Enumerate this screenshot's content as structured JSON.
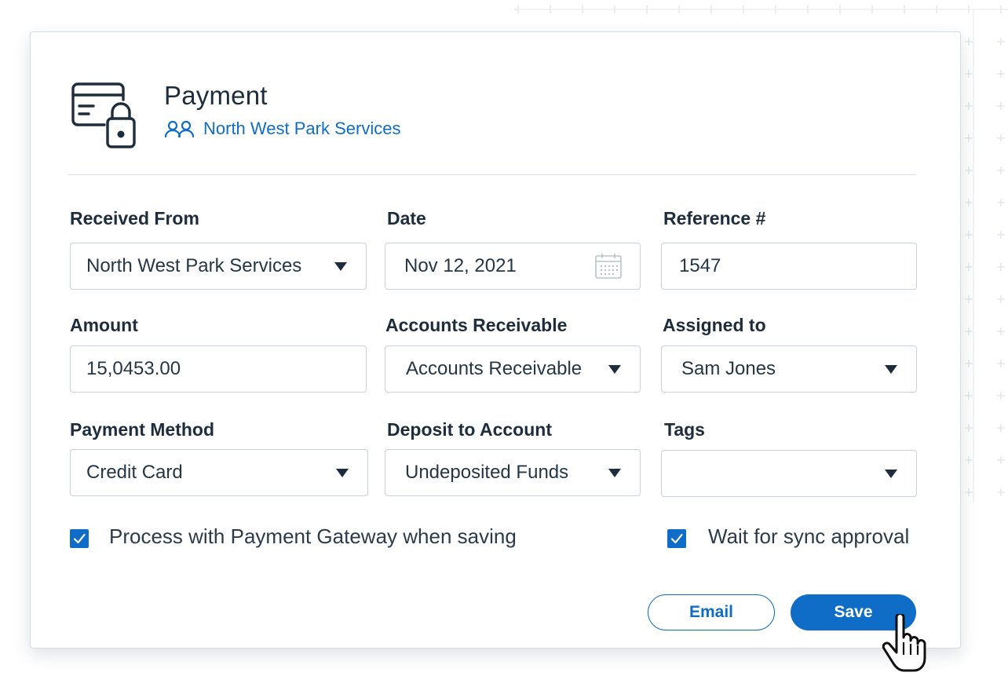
{
  "header": {
    "title": "Payment",
    "customer_link": "North West Park Services"
  },
  "fields": {
    "received_from": {
      "label": "Received From",
      "value": "North West Park Services"
    },
    "date": {
      "label": "Date",
      "value": "Nov 12, 2021"
    },
    "reference": {
      "label": "Reference #",
      "value": "1547"
    },
    "amount": {
      "label": "Amount",
      "value": "15,0453.00"
    },
    "accounts_receivable": {
      "label": "Accounts Receivable",
      "value": "Accounts Receivable"
    },
    "assigned_to": {
      "label": "Assigned to",
      "value": "Sam Jones"
    },
    "payment_method": {
      "label": "Payment Method",
      "value": "Credit Card"
    },
    "deposit_to": {
      "label": "Deposit to Account",
      "value": "Undeposited Funds"
    },
    "tags": {
      "label": "Tags",
      "value": ""
    }
  },
  "options": {
    "payment_gateway": {
      "label": "Process with Payment Gateway when saving",
      "checked": true
    },
    "sync_approval": {
      "label": "Wait for sync approval",
      "checked": true
    }
  },
  "actions": {
    "email_label": "Email",
    "save_label": "Save"
  },
  "colors": {
    "accent": "#0f6dc7",
    "text": "#1d2d3e",
    "border": "#c9d1da"
  },
  "icons": [
    "card-lock-icon",
    "users-icon",
    "calendar-icon",
    "chevron-down-icon",
    "checkmark-icon",
    "hand-pointer-icon"
  ]
}
